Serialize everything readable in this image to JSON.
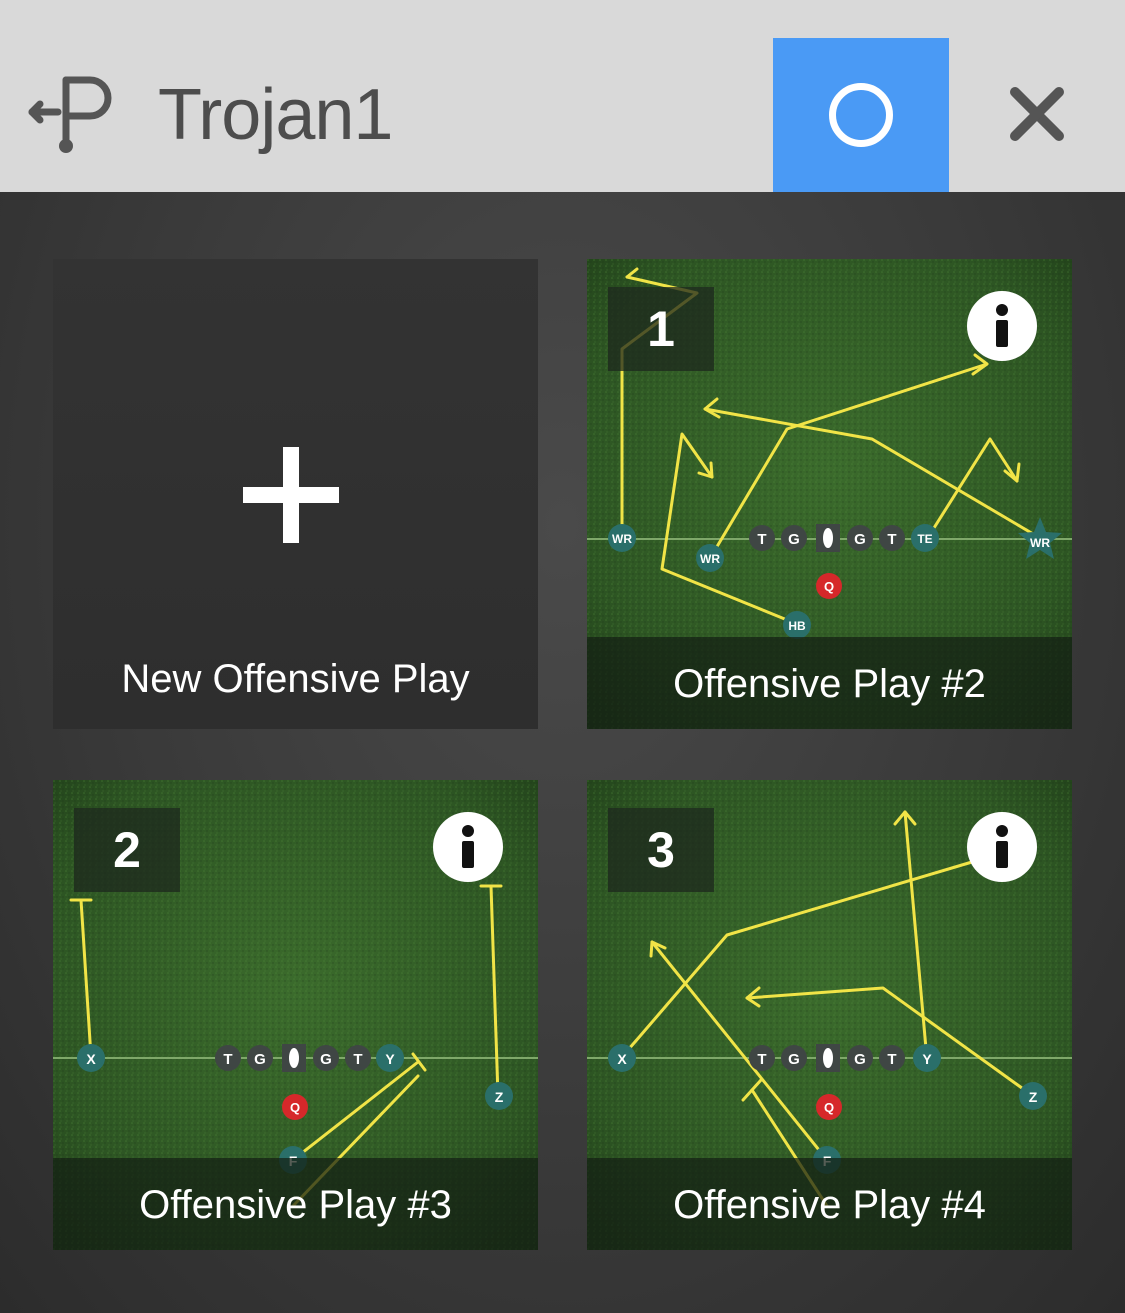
{
  "header": {
    "title": "Trojan1",
    "back_icon": "back-arrow-play-icon",
    "record_icon": "record-circle-icon",
    "close_icon": "close-x-icon",
    "record_color": "#4a9af5"
  },
  "new_play": {
    "label": "New Offensive Play",
    "icon": "plus-icon"
  },
  "plays": [
    {
      "number": "1",
      "name": "Offensive Play #2",
      "players": [
        "WR",
        "WR",
        "T",
        "G",
        "C",
        "G",
        "T",
        "TE",
        "WR",
        "Q",
        "HB"
      ]
    },
    {
      "number": "2",
      "name": "Offensive Play #3",
      "players": [
        "X",
        "T",
        "G",
        "C",
        "G",
        "T",
        "Y",
        "Q",
        "Z",
        "F"
      ]
    },
    {
      "number": "3",
      "name": "Offensive Play #4",
      "players": [
        "X",
        "T",
        "G",
        "C",
        "G",
        "T",
        "Y",
        "Q",
        "Z",
        "F"
      ]
    }
  ],
  "colors": {
    "route": "#f1e447",
    "skill_player": "#2a6f6a",
    "lineman": "#3f4644",
    "quarterback": "#d6282a",
    "turf": "#2f5a25"
  }
}
